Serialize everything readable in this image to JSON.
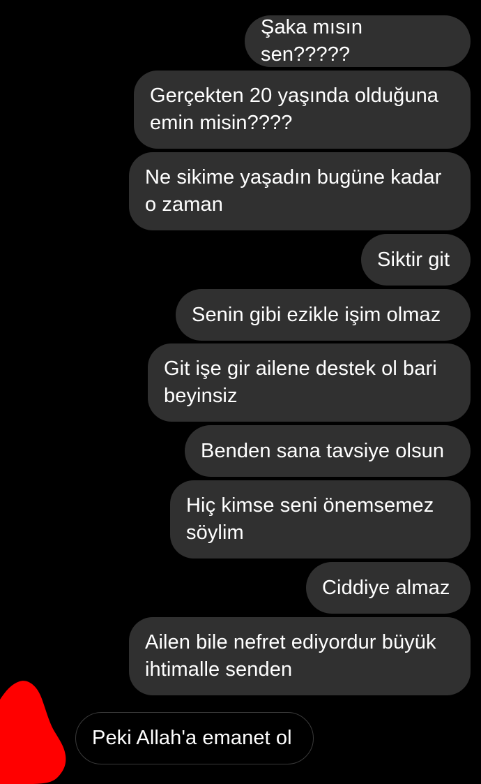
{
  "conversation": {
    "messages": [
      {
        "direction": "outgoing",
        "text": "Şaka mısın sen?????"
      },
      {
        "direction": "outgoing",
        "text": "Gerçekten 20 yaşında olduğuna\nemin misin????"
      },
      {
        "direction": "outgoing",
        "text": "Ne sikime yaşadın bugüne kadar\no zaman"
      },
      {
        "direction": "outgoing",
        "text": "Siktir git"
      },
      {
        "direction": "outgoing",
        "text": "Senin gibi ezikle işim olmaz"
      },
      {
        "direction": "outgoing",
        "text": "Git işe gir ailene destek ol bari\nbeyinsiz"
      },
      {
        "direction": "outgoing",
        "text": "Benden sana tavsiye olsun"
      },
      {
        "direction": "outgoing",
        "text": "Hiç kimse seni önemsemez\nsöylim"
      },
      {
        "direction": "outgoing",
        "text": "Ciddiye almaz"
      },
      {
        "direction": "outgoing",
        "text": "Ailen bile nefret ediyordur büyük\nihtimalle senden"
      },
      {
        "direction": "incoming",
        "text": "Peki Allah'a emanet ol"
      }
    ]
  },
  "colors": {
    "background": "#000000",
    "outgoing_bubble": "#303030",
    "incoming_bubble_border": "#3a3a3a",
    "text": "#ffffff",
    "redaction": "#ff0000"
  }
}
